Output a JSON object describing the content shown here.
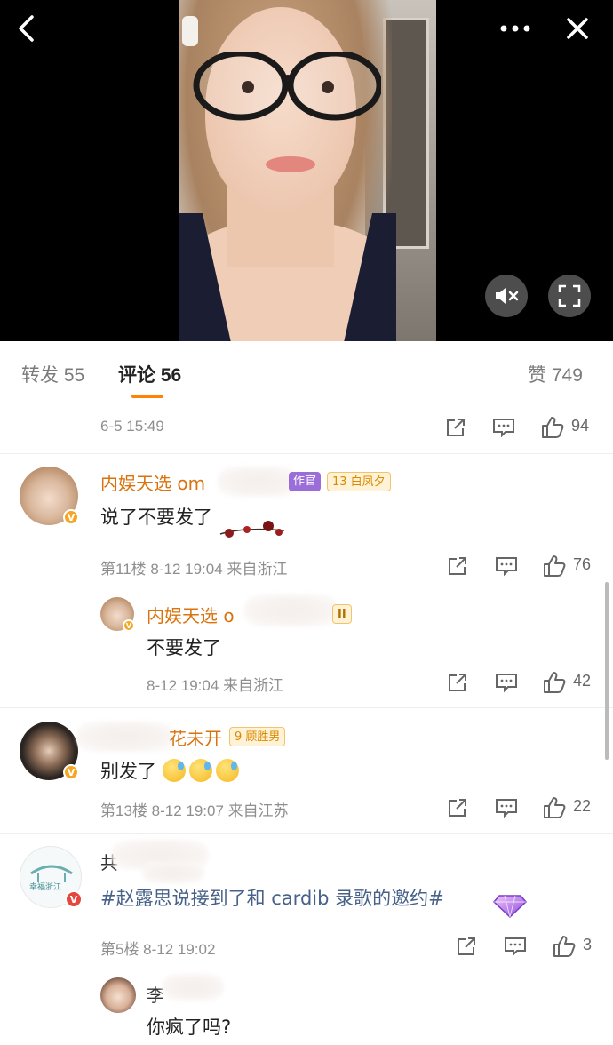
{
  "video": {
    "back_icon": "chevron-left-icon",
    "more_icon": "more-dots-icon",
    "close_icon": "close-icon",
    "mute_icon": "muted-speaker-icon",
    "fullscreen_icon": "fullscreen-icon"
  },
  "tabs": {
    "repost": "转发 55",
    "comments": "评论 56",
    "likes": "赞 749",
    "accent_color": "#ff8200"
  },
  "comments": [
    {
      "meta": "6-5 15:49",
      "likes": "94"
    },
    {
      "username": "内娱天选 om",
      "badge_role": "作官",
      "badge_level": "13 白凤夕",
      "text": "说了不要发了",
      "meta": "第11楼  8-12 19:04  来自浙江",
      "likes": "76",
      "reply": {
        "username": "内娱天选 o",
        "badge_level": "II",
        "text": "不要发了",
        "meta": "8-12 19:04  来自浙江",
        "likes": "42"
      }
    },
    {
      "username": "花未开",
      "badge_level": "9 顾胜男",
      "text": "别发了",
      "meta": "第13楼  8-12 19:07  来自江苏",
      "likes": "22"
    },
    {
      "username": "共",
      "avatar_text": "幸福浙江",
      "text": "#赵露思说接到了和 cardib 录歌的邀约#",
      "meta": "第5楼  8-12 19:02",
      "likes": "3",
      "reply": {
        "username": "李",
        "text": "你疯了吗?"
      }
    }
  ],
  "colors": {
    "username": "#d9730d",
    "topic": "#476189",
    "meta": "#8e8e8e"
  }
}
